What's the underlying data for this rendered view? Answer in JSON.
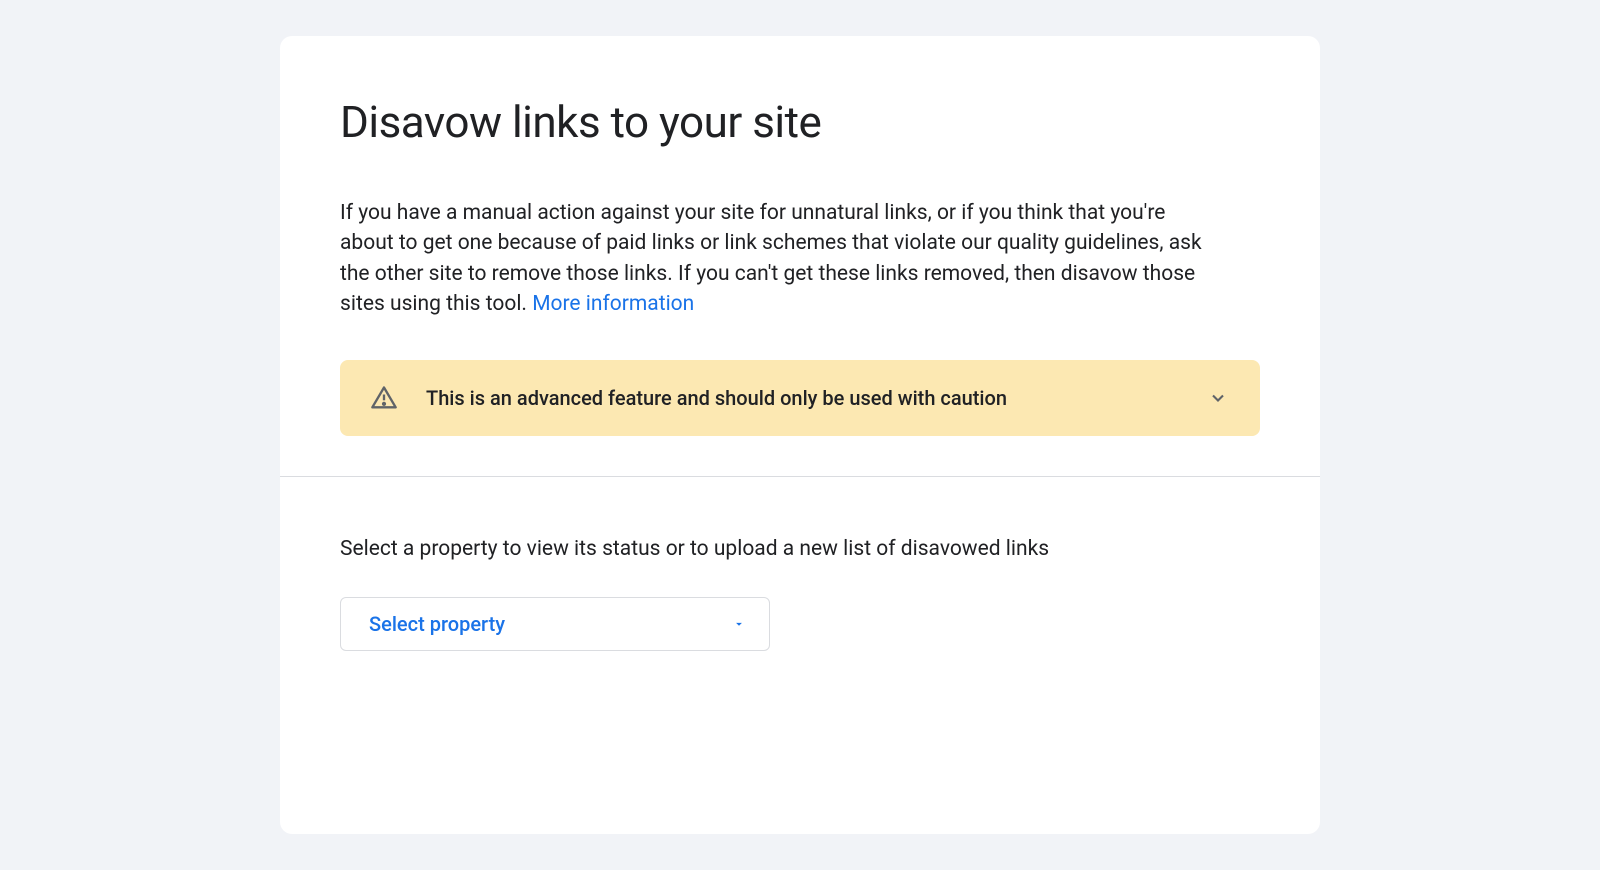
{
  "header": {
    "title": "Disavow links to your site"
  },
  "description": {
    "text": "If you have a manual action against your site for unnatural links, or if you think that you're about to get one because of paid links or link schemes that violate our quality guidelines, ask the other site to remove those links. If you can't get these links removed, then disavow those sites using this tool. ",
    "link_text": "More information"
  },
  "warning": {
    "text": "This is an advanced feature and should only be used with caution"
  },
  "property_section": {
    "label": "Select a property to view its status or to upload a new list of disavowed links",
    "select_placeholder": "Select property"
  },
  "colors": {
    "background": "#f1f3f7",
    "card": "#ffffff",
    "text": "#202124",
    "link": "#1a73e8",
    "warning_bg": "#fce8b2",
    "border": "#dadce0"
  }
}
